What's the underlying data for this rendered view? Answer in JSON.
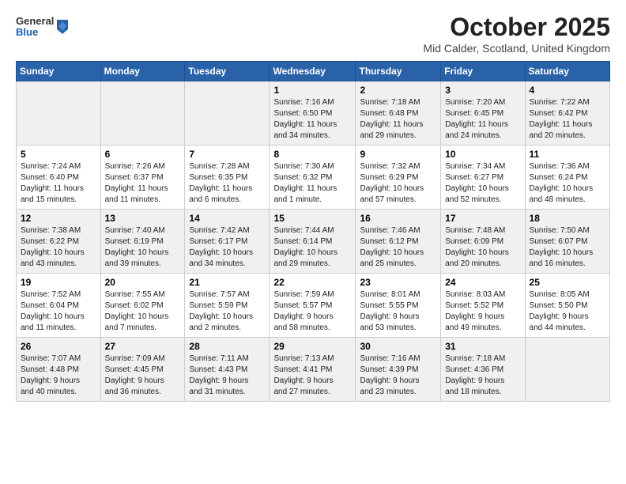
{
  "header": {
    "logo_general": "General",
    "logo_blue": "Blue",
    "title": "October 2025",
    "subtitle": "Mid Calder, Scotland, United Kingdom"
  },
  "calendar": {
    "headers": [
      "Sunday",
      "Monday",
      "Tuesday",
      "Wednesday",
      "Thursday",
      "Friday",
      "Saturday"
    ],
    "weeks": [
      [
        {
          "day": "",
          "info": ""
        },
        {
          "day": "",
          "info": ""
        },
        {
          "day": "",
          "info": ""
        },
        {
          "day": "1",
          "info": "Sunrise: 7:16 AM\nSunset: 6:50 PM\nDaylight: 11 hours\nand 34 minutes."
        },
        {
          "day": "2",
          "info": "Sunrise: 7:18 AM\nSunset: 6:48 PM\nDaylight: 11 hours\nand 29 minutes."
        },
        {
          "day": "3",
          "info": "Sunrise: 7:20 AM\nSunset: 6:45 PM\nDaylight: 11 hours\nand 24 minutes."
        },
        {
          "day": "4",
          "info": "Sunrise: 7:22 AM\nSunset: 6:42 PM\nDaylight: 11 hours\nand 20 minutes."
        }
      ],
      [
        {
          "day": "5",
          "info": "Sunrise: 7:24 AM\nSunset: 6:40 PM\nDaylight: 11 hours\nand 15 minutes."
        },
        {
          "day": "6",
          "info": "Sunrise: 7:26 AM\nSunset: 6:37 PM\nDaylight: 11 hours\nand 11 minutes."
        },
        {
          "day": "7",
          "info": "Sunrise: 7:28 AM\nSunset: 6:35 PM\nDaylight: 11 hours\nand 6 minutes."
        },
        {
          "day": "8",
          "info": "Sunrise: 7:30 AM\nSunset: 6:32 PM\nDaylight: 11 hours\nand 1 minute."
        },
        {
          "day": "9",
          "info": "Sunrise: 7:32 AM\nSunset: 6:29 PM\nDaylight: 10 hours\nand 57 minutes."
        },
        {
          "day": "10",
          "info": "Sunrise: 7:34 AM\nSunset: 6:27 PM\nDaylight: 10 hours\nand 52 minutes."
        },
        {
          "day": "11",
          "info": "Sunrise: 7:36 AM\nSunset: 6:24 PM\nDaylight: 10 hours\nand 48 minutes."
        }
      ],
      [
        {
          "day": "12",
          "info": "Sunrise: 7:38 AM\nSunset: 6:22 PM\nDaylight: 10 hours\nand 43 minutes."
        },
        {
          "day": "13",
          "info": "Sunrise: 7:40 AM\nSunset: 6:19 PM\nDaylight: 10 hours\nand 39 minutes."
        },
        {
          "day": "14",
          "info": "Sunrise: 7:42 AM\nSunset: 6:17 PM\nDaylight: 10 hours\nand 34 minutes."
        },
        {
          "day": "15",
          "info": "Sunrise: 7:44 AM\nSunset: 6:14 PM\nDaylight: 10 hours\nand 29 minutes."
        },
        {
          "day": "16",
          "info": "Sunrise: 7:46 AM\nSunset: 6:12 PM\nDaylight: 10 hours\nand 25 minutes."
        },
        {
          "day": "17",
          "info": "Sunrise: 7:48 AM\nSunset: 6:09 PM\nDaylight: 10 hours\nand 20 minutes."
        },
        {
          "day": "18",
          "info": "Sunrise: 7:50 AM\nSunset: 6:07 PM\nDaylight: 10 hours\nand 16 minutes."
        }
      ],
      [
        {
          "day": "19",
          "info": "Sunrise: 7:52 AM\nSunset: 6:04 PM\nDaylight: 10 hours\nand 11 minutes."
        },
        {
          "day": "20",
          "info": "Sunrise: 7:55 AM\nSunset: 6:02 PM\nDaylight: 10 hours\nand 7 minutes."
        },
        {
          "day": "21",
          "info": "Sunrise: 7:57 AM\nSunset: 5:59 PM\nDaylight: 10 hours\nand 2 minutes."
        },
        {
          "day": "22",
          "info": "Sunrise: 7:59 AM\nSunset: 5:57 PM\nDaylight: 9 hours\nand 58 minutes."
        },
        {
          "day": "23",
          "info": "Sunrise: 8:01 AM\nSunset: 5:55 PM\nDaylight: 9 hours\nand 53 minutes."
        },
        {
          "day": "24",
          "info": "Sunrise: 8:03 AM\nSunset: 5:52 PM\nDaylight: 9 hours\nand 49 minutes."
        },
        {
          "day": "25",
          "info": "Sunrise: 8:05 AM\nSunset: 5:50 PM\nDaylight: 9 hours\nand 44 minutes."
        }
      ],
      [
        {
          "day": "26",
          "info": "Sunrise: 7:07 AM\nSunset: 4:48 PM\nDaylight: 9 hours\nand 40 minutes."
        },
        {
          "day": "27",
          "info": "Sunrise: 7:09 AM\nSunset: 4:45 PM\nDaylight: 9 hours\nand 36 minutes."
        },
        {
          "day": "28",
          "info": "Sunrise: 7:11 AM\nSunset: 4:43 PM\nDaylight: 9 hours\nand 31 minutes."
        },
        {
          "day": "29",
          "info": "Sunrise: 7:13 AM\nSunset: 4:41 PM\nDaylight: 9 hours\nand 27 minutes."
        },
        {
          "day": "30",
          "info": "Sunrise: 7:16 AM\nSunset: 4:39 PM\nDaylight: 9 hours\nand 23 minutes."
        },
        {
          "day": "31",
          "info": "Sunrise: 7:18 AM\nSunset: 4:36 PM\nDaylight: 9 hours\nand 18 minutes."
        },
        {
          "day": "",
          "info": ""
        }
      ]
    ],
    "shaded_weeks": [
      0,
      2,
      4
    ]
  }
}
